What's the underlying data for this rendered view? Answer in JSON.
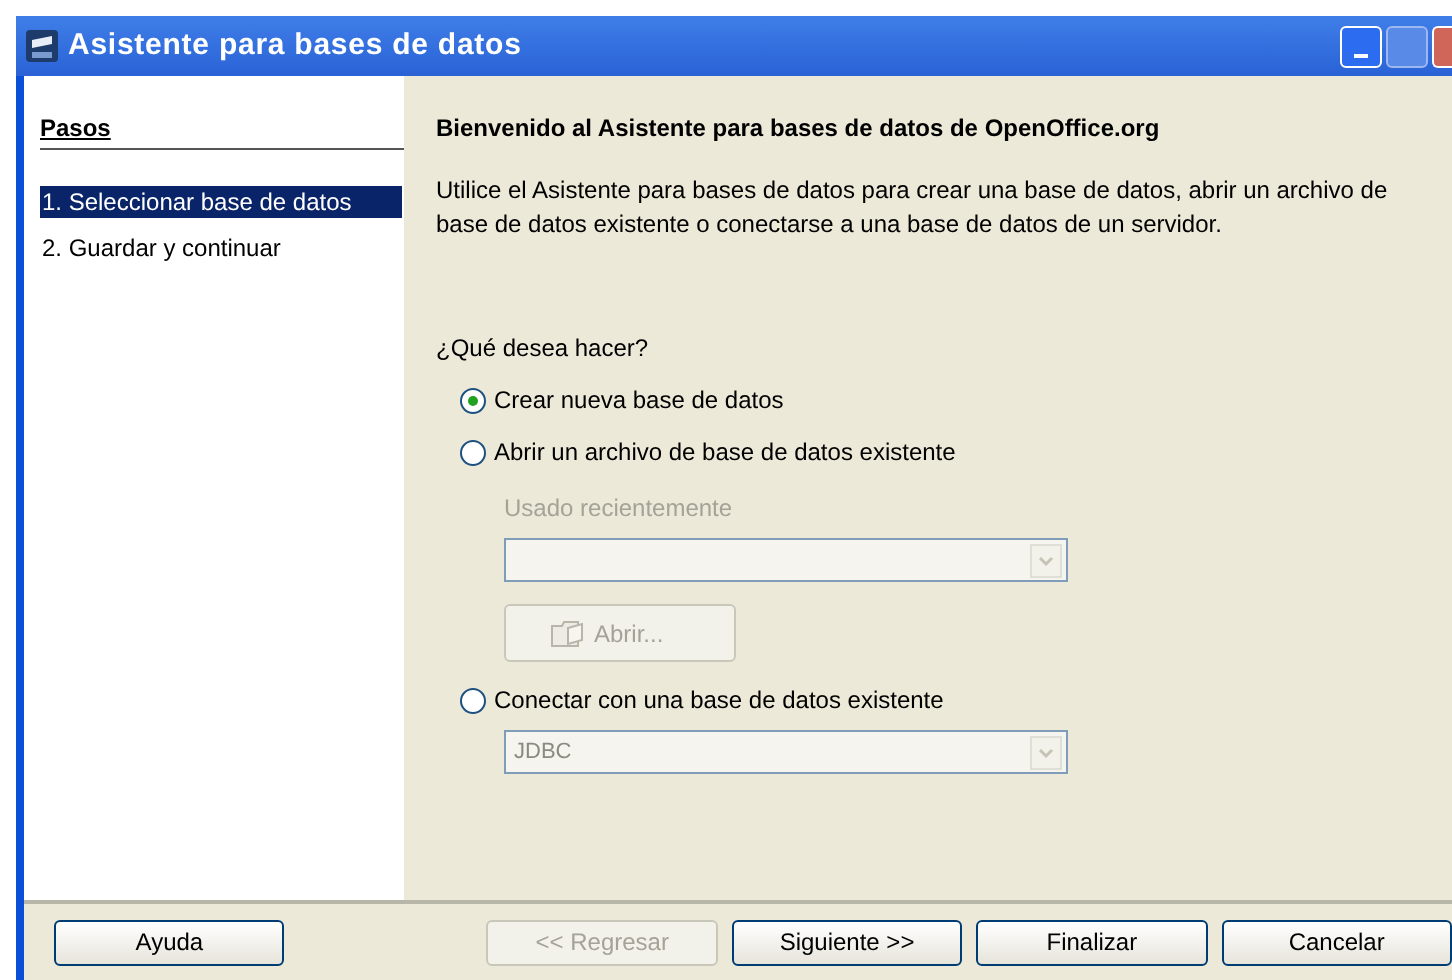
{
  "window": {
    "title": "Asistente para bases de datos"
  },
  "steps": {
    "heading": "Pasos",
    "items": [
      {
        "label": "1. Seleccionar base de datos",
        "selected": true
      },
      {
        "label": "2. Guardar y continuar",
        "selected": false
      }
    ]
  },
  "content": {
    "heading": "Bienvenido al Asistente para bases de datos de OpenOffice.org",
    "intro": "Utilice el Asistente para bases de datos para crear una base de datos, abrir un archivo de base de datos existente o conectarse a una base de datos de un servidor.",
    "question": "¿Qué desea hacer?",
    "options": [
      {
        "label": "Crear nueva base de datos",
        "selected": true
      },
      {
        "label": "Abrir un archivo de base de datos existente",
        "selected": false
      },
      {
        "label": "Conectar con una base de datos existente",
        "selected": false
      }
    ],
    "recent": {
      "label": "Usado recientemente",
      "disabled": true
    },
    "open_button": {
      "label": "Abrir...",
      "disabled": true
    },
    "connection": {
      "value": "JDBC",
      "disabled": true
    }
  },
  "buttons": [
    {
      "label": "Ayuda",
      "disabled": false
    },
    {
      "label": "<< Regresar",
      "disabled": true
    },
    {
      "label": "Siguiente >>",
      "disabled": false
    },
    {
      "label": "Finalizar",
      "disabled": false
    },
    {
      "label": "Cancelar",
      "disabled": false
    }
  ]
}
